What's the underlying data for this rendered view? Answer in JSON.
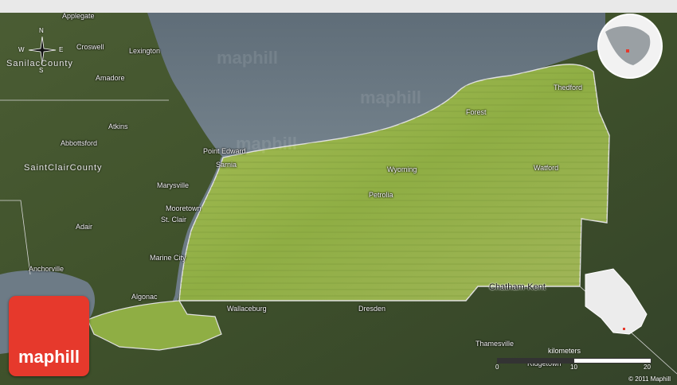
{
  "map": {
    "watermarks": [
      "maphill",
      "maphill",
      "maphill"
    ],
    "compass": {
      "n": "N",
      "s": "S",
      "e": "E",
      "w": "W"
    },
    "counties": [
      {
        "key": "sanilac",
        "label": "SanilacCounty"
      },
      {
        "key": "stclair",
        "label": "SaintClairCounty"
      }
    ],
    "places": {
      "applegate": "Applegate",
      "croswell": "Croswell",
      "lexington": "Lexington",
      "amadore": "Amadore",
      "atkins": "Atkins",
      "abbottsford": "Abbottsford",
      "marysville": "Marysville",
      "adair": "Adair",
      "anchorville": "Anchorville",
      "point_edward": "Point Edward",
      "sarnia": "Sarnia",
      "mooretown": "Mooretown",
      "st_clair": "St. Clair",
      "marine_city": "Marine City",
      "algonac": "Algonac",
      "wallaceburg": "Wallaceburg",
      "dresden": "Dresden",
      "thamesville": "Thamesville",
      "ridgetown": "Ridgetown",
      "thedford": "Thedford",
      "forest": "Forest",
      "wyoming": "Wyoming",
      "watford": "Watford",
      "petrolia": "Petrolia",
      "chatham_kent": "Chatham-Kent"
    },
    "logo_text": "maphill",
    "scale": {
      "title": "kilometers",
      "ticks": [
        "0",
        "10",
        "20"
      ]
    },
    "copyright": "© 2011 Maphill",
    "colors": {
      "lake": "#6b7a86",
      "region": "#8fae4a",
      "border": "#e8e8e8",
      "logo": "#e6392c"
    }
  }
}
